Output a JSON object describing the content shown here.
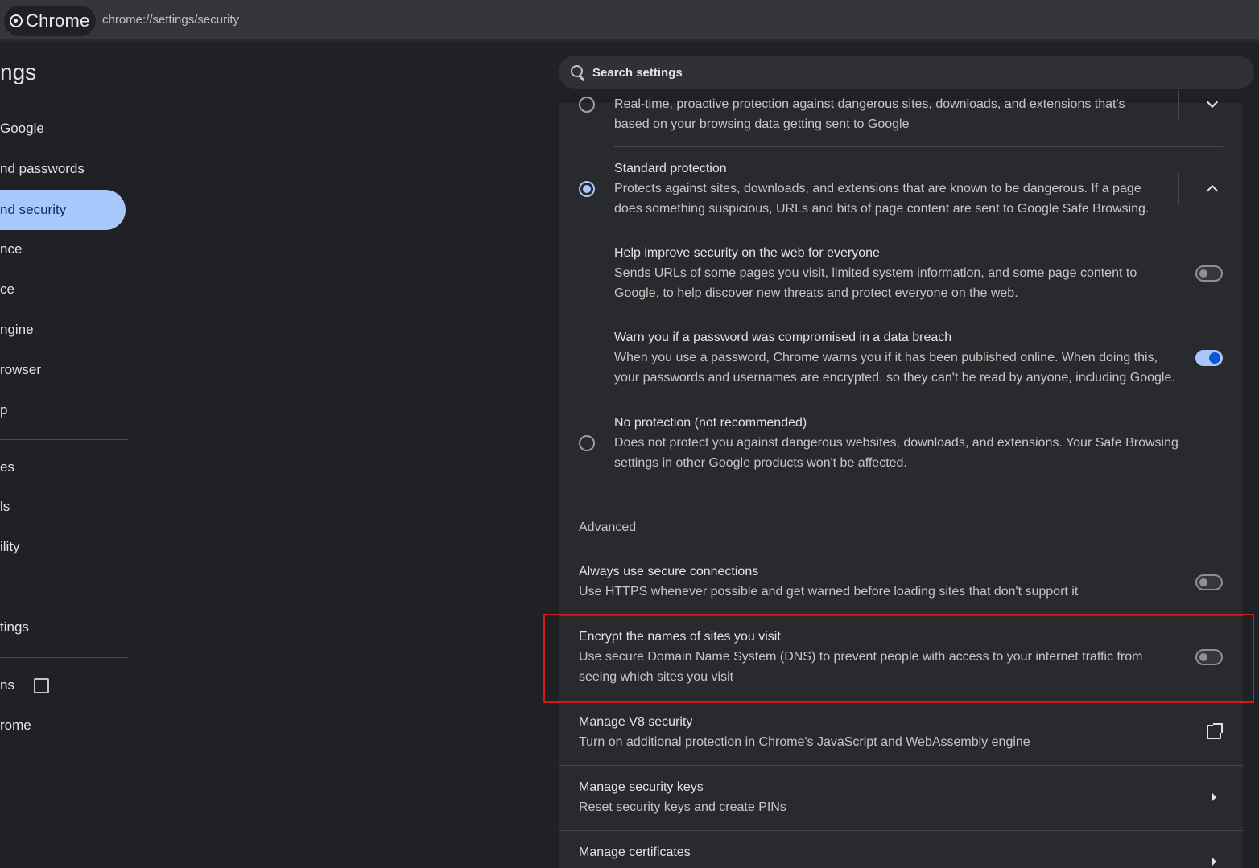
{
  "browser": {
    "chip_label": "Chrome",
    "url": "chrome://settings/security"
  },
  "header": {
    "title": "ngs",
    "search_placeholder": "Search settings"
  },
  "sidebar": {
    "items": [
      {
        "label": "Google"
      },
      {
        "label": "nd passwords"
      },
      {
        "label": "nd security"
      },
      {
        "label": "nce"
      },
      {
        "label": "ce"
      },
      {
        "label": "ngine"
      },
      {
        "label": "rowser"
      },
      {
        "label": "p"
      },
      {
        "label": "es"
      },
      {
        "label": "ls"
      },
      {
        "label": "ility"
      },
      {
        "label": "tings"
      },
      {
        "label": "ns"
      },
      {
        "label": "rome"
      }
    ],
    "active_index": 2
  },
  "safe_browsing": {
    "enhanced": {
      "description_line1": "Real-time, proactive protection against dangerous sites, downloads, and extensions that's",
      "description_line2": "based on your browsing data getting sent to Google",
      "selected": false
    },
    "standard": {
      "title": "Standard protection",
      "description_line1": "Protects against sites, downloads, and extensions that are known to be dangerous. If a page",
      "description_line2": "does something suspicious, URLs and bits of page content are sent to Google Safe Browsing.",
      "selected": true
    },
    "help_improve": {
      "title": "Help improve security on the web for everyone",
      "description_line1": "Sends URLs of some pages you visit, limited system information, and some page content to",
      "description_line2": "Google, to help discover new threats and protect everyone on the web.",
      "enabled": false
    },
    "password_warn": {
      "title": "Warn you if a password was compromised in a data breach",
      "description_line1": "When you use a password, Chrome warns you if it has been published online. When doing this,",
      "description_line2": "your passwords and usernames are encrypted, so they can't be read by anyone, including Google.",
      "enabled": true
    },
    "no_protection": {
      "title": "No protection (not recommended)",
      "description_line1": "Does not protect you against dangerous websites, downloads, and extensions. Your Safe Browsing",
      "description_line2": "settings in other Google products won't be affected.",
      "selected": false
    }
  },
  "advanced": {
    "label": "Advanced",
    "secure_connections": {
      "title": "Always use secure connections",
      "description": "Use HTTPS whenever possible and get warned before loading sites that don't support it",
      "enabled": false
    },
    "secure_dns": {
      "title": "Encrypt the names of sites you visit",
      "description_line1": "Use secure Domain Name System (DNS) to prevent people with access to your internet traffic from",
      "description_line2": "seeing which sites you visit",
      "enabled": false
    },
    "v8_security": {
      "title": "Manage V8 security",
      "description": "Turn on additional protection in Chrome's JavaScript and WebAssembly engine"
    },
    "security_keys": {
      "title": "Manage security keys",
      "description": "Reset security keys and create PINs"
    },
    "certificates": {
      "title": "Manage certificates"
    }
  },
  "colors": {
    "accent": "#a8c7fa",
    "highlight_border": "#d11a1a",
    "background": "#202124",
    "card": "#292a2d"
  }
}
